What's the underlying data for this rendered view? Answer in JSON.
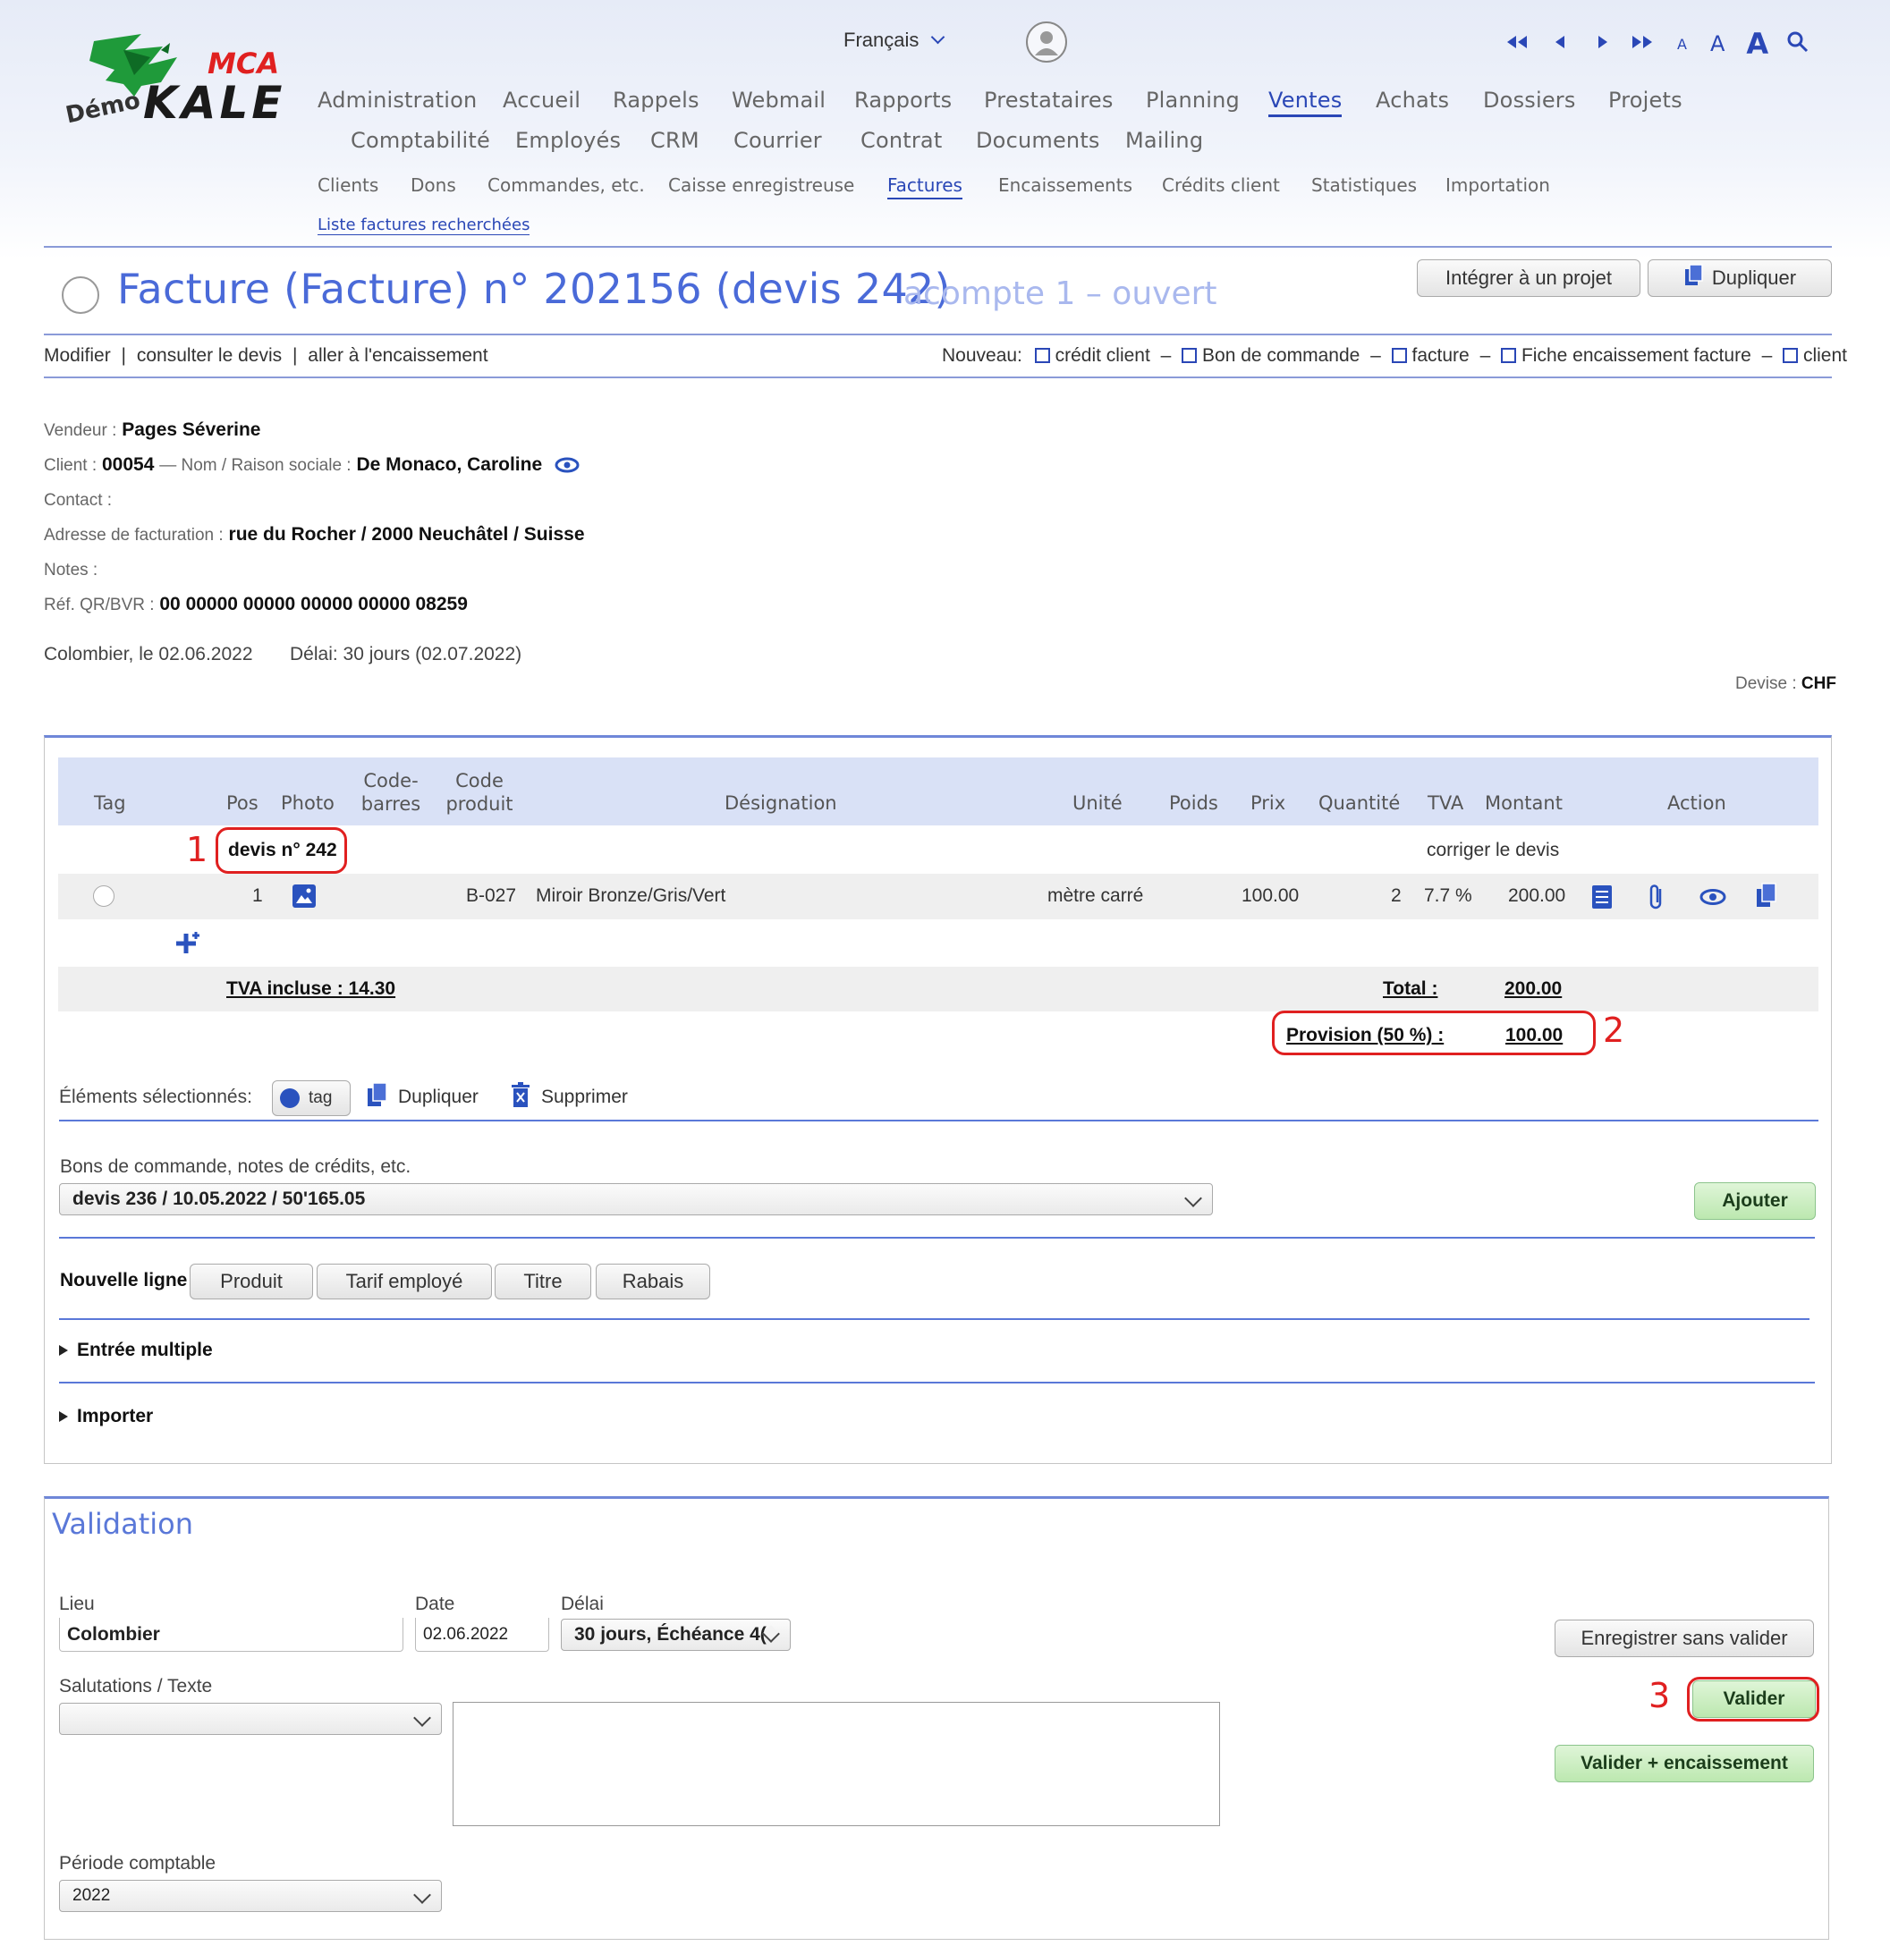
{
  "header": {
    "language": "Français",
    "logo_text_top": "MCA",
    "logo_text_left": "Démo",
    "logo_text_main": "KALE",
    "main_nav": [
      "Administration",
      "Accueil",
      "Rappels",
      "Webmail",
      "Rapports",
      "Prestataires",
      "Planning",
      "Ventes",
      "Achats",
      "Dossiers",
      "Projets",
      "Comptabilité",
      "Employés",
      "CRM",
      "Courrier",
      "Contrat",
      "Documents",
      "Mailing"
    ],
    "active_main": "Ventes",
    "sub_nav": [
      "Clients",
      "Dons",
      "Commandes, etc.",
      "Caisse enregistreuse",
      "Factures",
      "Encaissements",
      "Crédits client",
      "Statistiques",
      "Importation"
    ],
    "active_sub": "Factures",
    "sub_link": "Liste factures recherchées",
    "font_size_letters": [
      "A",
      "A",
      "A"
    ]
  },
  "page": {
    "title": "Facture (Facture) n° 202156 (devis 242)",
    "status": "acompte 1 – ouvert",
    "btn_integrate": "Intégrer à un projet",
    "btn_duplicate": "Dupliquer",
    "actions": {
      "modify": "Modifier",
      "sep1": "|",
      "consult": "consulter le devis",
      "sep2": "|",
      "goto": "aller à l'encaissement"
    },
    "new_label": "Nouveau:",
    "new_links": [
      "crédit client",
      "Bon de commande",
      "facture",
      "Fiche encaissement facture",
      "client"
    ],
    "new_sep": "–"
  },
  "info": {
    "vendeur_label": "Vendeur :",
    "vendeur": "Pages Séverine",
    "client_label": "Client :",
    "client_no": "00054",
    "nom_label": "— Nom / Raison sociale :",
    "client_name": "De Monaco, Caroline",
    "contact_label": "Contact :",
    "adresse_label": "Adresse de facturation :",
    "adresse": "rue du Rocher / 2000 Neuchâtel / Suisse",
    "notes_label": "Notes :",
    "ref_label": "Réf. QR/BVR :",
    "ref": "00 00000 00000 00000 00000 08259",
    "place_date": "Colombier, le 02.06.2022",
    "delai": "Délai: 30 jours (02.07.2022)",
    "devise_label": "Devise :",
    "devise": "CHF"
  },
  "table": {
    "headers": {
      "tag": "Tag",
      "pos": "Pos",
      "photo": "Photo",
      "code_barres_1": "Code-",
      "code_barres_2": "barres",
      "code_produit_1": "Code",
      "code_produit_2": "produit",
      "designation": "Désignation",
      "unite": "Unité",
      "poids": "Poids",
      "prix": "Prix",
      "quantite": "Quantité",
      "tva": "TVA",
      "montant": "Montant",
      "action": "Action"
    },
    "group_label": "devis n° 242",
    "group_action": "corriger le devis",
    "rows": [
      {
        "pos": "1",
        "code": "B-027",
        "designation": "Miroir Bronze/Gris/Vert",
        "unite": "mètre carré",
        "prix": "100.00",
        "quantite": "2",
        "tva": "7.7 %",
        "montant": "200.00"
      }
    ],
    "tva_incluse": "TVA incluse : 14.30",
    "total_label": "Total :",
    "total": "200.00",
    "provision_label": "Provision (50 %) :",
    "provision": "100.00"
  },
  "annotations": {
    "n1": "1",
    "n2": "2",
    "n3": "3"
  },
  "selected": {
    "label": "Éléments sélectionnés:",
    "tag": "tag",
    "duplicate": "Dupliquer",
    "delete": "Supprimer"
  },
  "bons": {
    "label": "Bons de commande, notes de crédits, etc.",
    "selected": "devis 236 / 10.05.2022 / 50'165.05",
    "add": "Ajouter"
  },
  "new_line": {
    "label": "Nouvelle ligne",
    "buttons": [
      "Produit",
      "Tarif employé",
      "Titre",
      "Rabais"
    ]
  },
  "sections": {
    "multiple": "Entrée multiple",
    "import": "Importer"
  },
  "validation": {
    "title": "Validation",
    "lieu_label": "Lieu",
    "lieu": "Colombier",
    "date_label": "Date",
    "date": "02.06.2022",
    "delai_label": "Délai",
    "delai": "30 jours, Échéance 4(",
    "salutations_label": "Salutations / Texte",
    "periode_label": "Période comptable",
    "periode": "2022",
    "btn_save": "Enregistrer sans valider",
    "btn_validate": "Valider",
    "btn_validate_enc": "Valider + encaissement"
  },
  "colors": {
    "accent": "#2a47b6",
    "title_blue": "#4a6ad8",
    "annotation_red": "#e02020",
    "green_button": "#bce8b0",
    "header_row": "#d9e1f6"
  }
}
